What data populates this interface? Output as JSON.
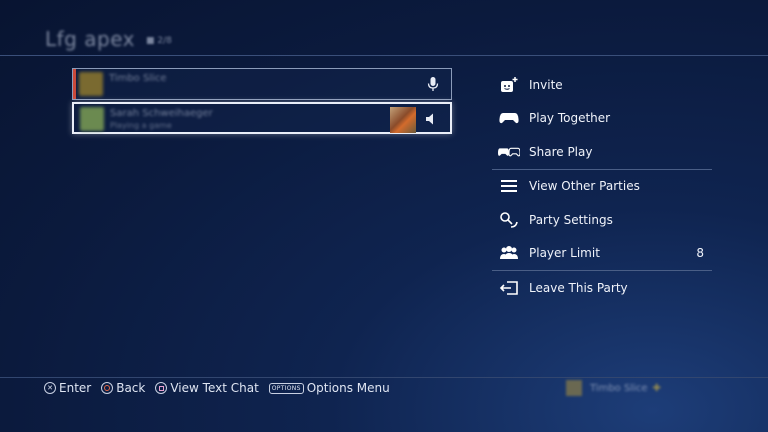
{
  "header": {
    "title": "Lfg apex",
    "member_count": "2/8"
  },
  "members": [
    {
      "name": "Timbo Slice",
      "status": "",
      "voice_icon": "microphone-icon",
      "accent": "#c9493a",
      "avatar_color": "#7a6a30"
    },
    {
      "name": "Sarah Schweihaeger",
      "status": "Playing a game",
      "voice_icon": "speaker-icon",
      "avatar_color": "#6b8a50"
    }
  ],
  "menu": {
    "invite": "Invite",
    "play_together": "Play Together",
    "share_play": "Share Play",
    "view_other_parties": "View Other Parties",
    "party_settings": "Party Settings",
    "player_limit": "Player Limit",
    "player_limit_value": "8",
    "leave_party": "Leave This Party"
  },
  "footer": {
    "enter": "Enter",
    "back": "Back",
    "view_text_chat": "View Text Chat",
    "options_badge": "OPTIONS",
    "options_menu": "Options Menu"
  },
  "user": {
    "name": "Timbo Slice",
    "plus": "✚"
  },
  "colors": {
    "accent_red": "#c9493a",
    "background": "#0b1a3d",
    "plus_gold": "#e8c33a"
  }
}
